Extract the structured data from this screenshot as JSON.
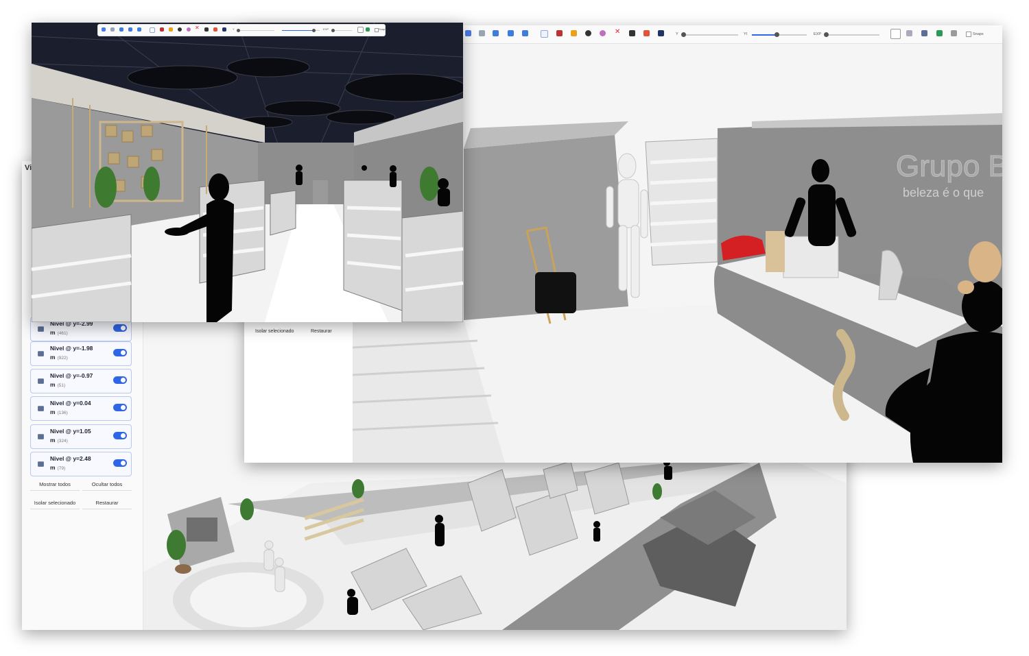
{
  "back_window": {
    "panel": {
      "title": "Vi",
      "levels": [
        {
          "label_line1": "Nivel @ y=-2.99",
          "label_line2": "m",
          "count": "(461)"
        },
        {
          "label_line1": "Nivel @ y=-1.98",
          "label_line2": "m",
          "count": "(922)"
        },
        {
          "label_line1": "Nivel @ y=-0.97",
          "label_line2": "m",
          "count": "(51)"
        },
        {
          "label_line1": "Nivel @ y=0.04",
          "label_line2": "m",
          "count": "(136)"
        },
        {
          "label_line1": "Nivel @ y=1.05",
          "label_line2": "m",
          "count": "(324)"
        },
        {
          "label_line1": "Nivel @ y=2.48",
          "label_line2": "m",
          "count": "(79)"
        }
      ],
      "show_all": "Mostrar todos",
      "hide_all": "Ocultar todos",
      "isolate": "Isolar selecionado",
      "restore": "Restaurar"
    }
  },
  "right_window": {
    "toolbar": {
      "y_label": "Y",
      "yi_label": "YI",
      "exp_label": "EXP",
      "snaps_label": "Snaps",
      "y_value": 0.0,
      "yi_value": 0.45,
      "exp_value": 0.0
    },
    "overlay_panel": {
      "isolate": "Isolar selecionado",
      "restore": "Restaurar"
    },
    "wall_sign": {
      "brand": "Grupo Bo",
      "tagline": "beleza é o que"
    }
  },
  "front_window": {
    "toolbar": {
      "y_label": "Y",
      "exp_label": "EXP",
      "snaps_label": "Snaps",
      "yi_value": 0.85
    }
  },
  "colors": {
    "accent": "#2f66e8",
    "ceiling": "#1b1e2c",
    "wall": "#7a7a7a",
    "floor": "#f2f2f2",
    "silhouette": "#050505",
    "red_bag": "#d41f23",
    "wood": "#d9c19a"
  }
}
